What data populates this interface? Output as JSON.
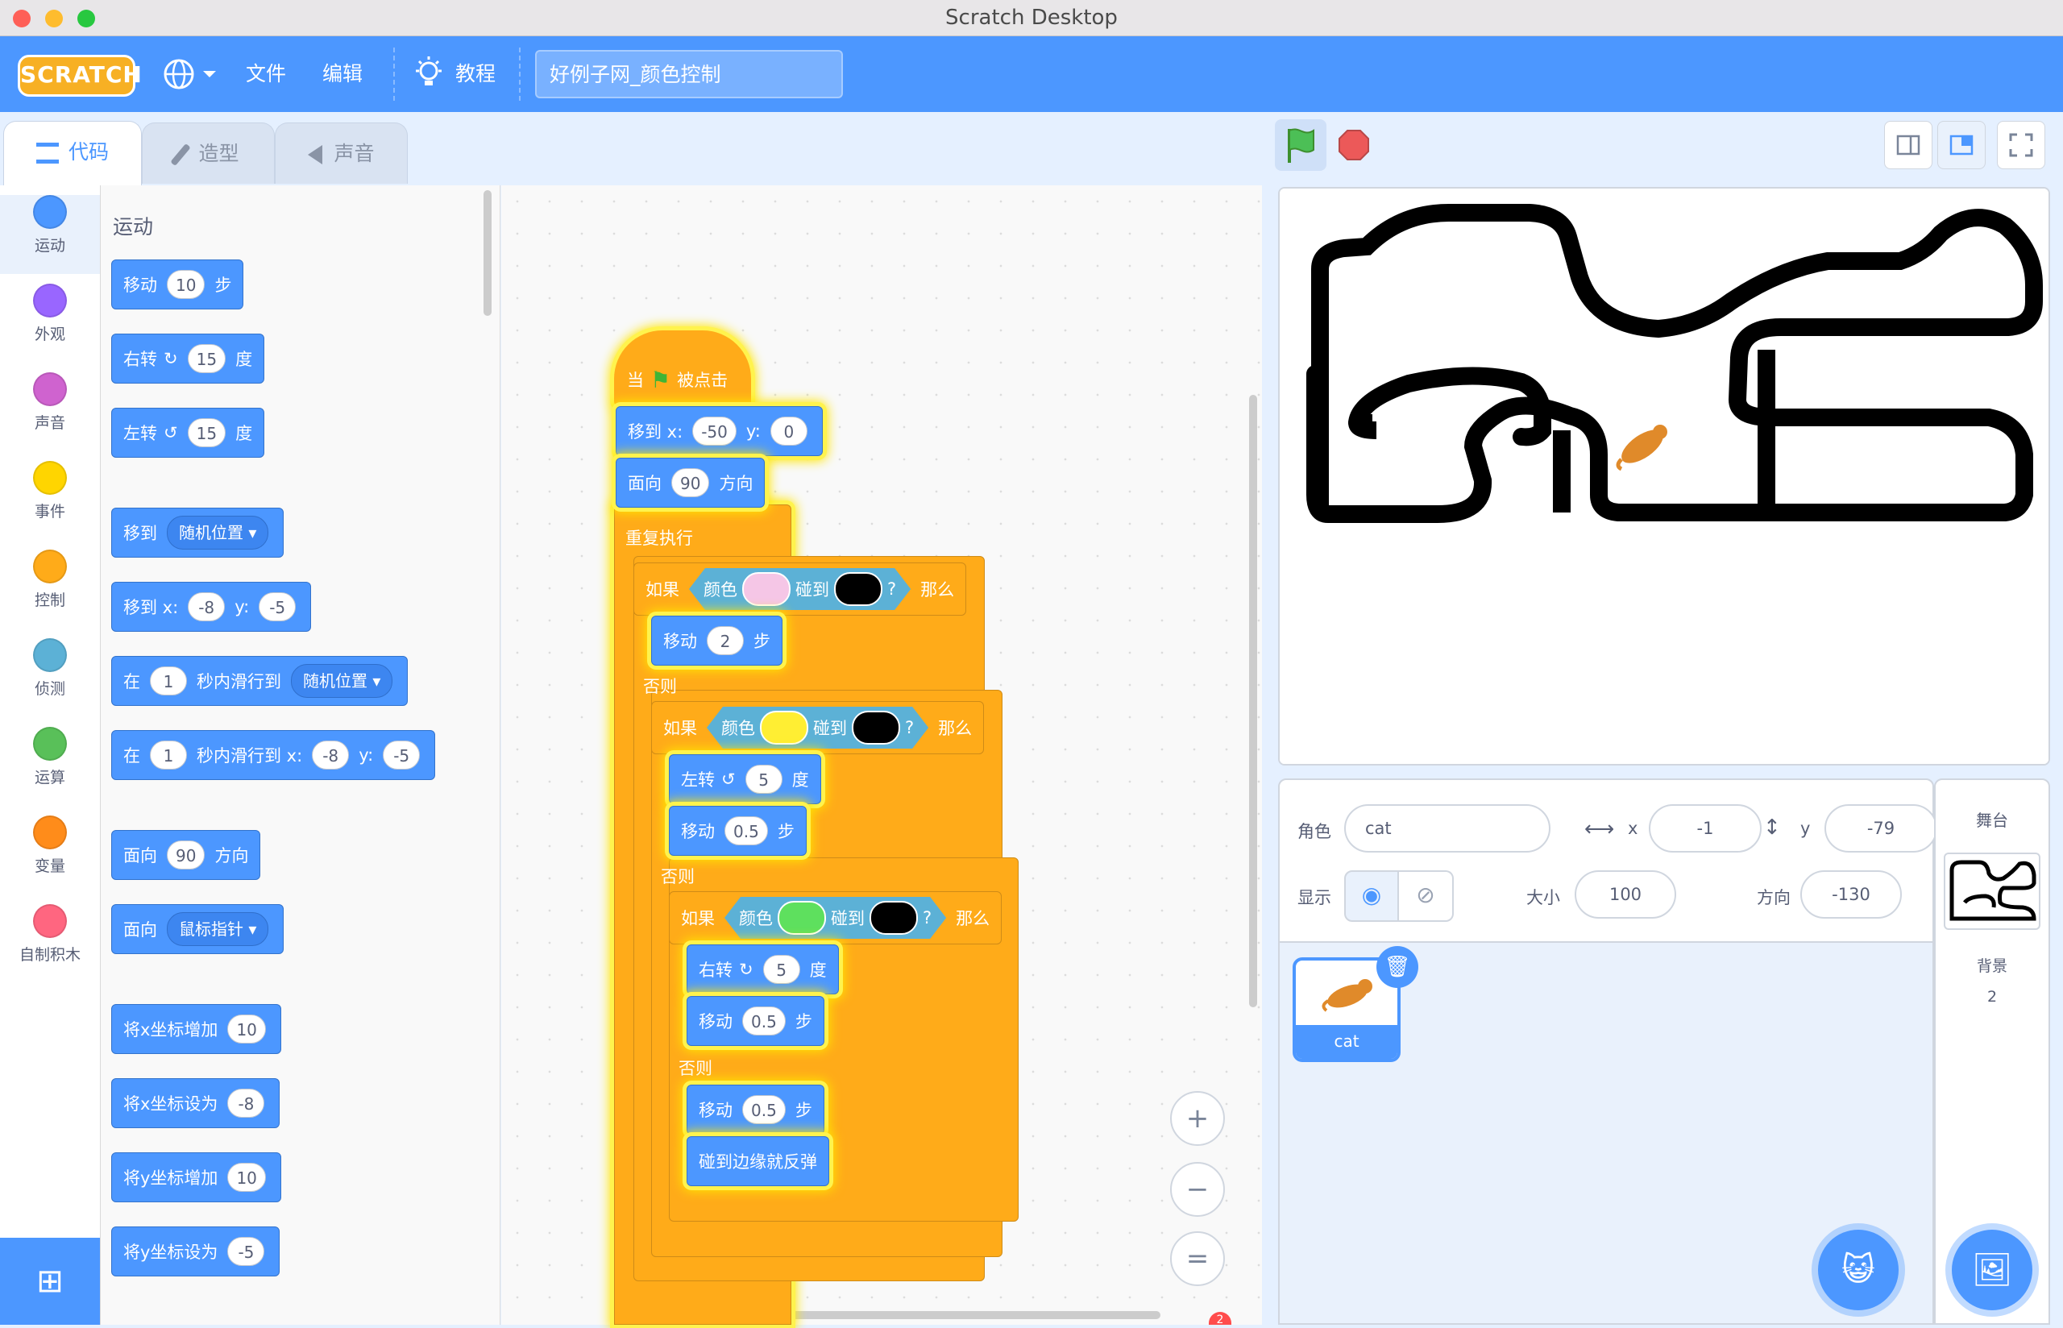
{
  "window": {
    "title": "Scratch Desktop"
  },
  "menubar": {
    "logo": "SCRATCH",
    "file": "文件",
    "edit": "编辑",
    "tutorials": "教程",
    "project_title": "好例子网_颜色控制"
  },
  "tabs": {
    "code": "代码",
    "costumes": "造型",
    "sounds": "声音"
  },
  "categories": [
    {
      "label": "运动",
      "color": "#4c97ff"
    },
    {
      "label": "外观",
      "color": "#9966ff"
    },
    {
      "label": "声音",
      "color": "#cf63cf"
    },
    {
      "label": "事件",
      "color": "#ffd500"
    },
    {
      "label": "控制",
      "color": "#ffab19"
    },
    {
      "label": "侦测",
      "color": "#5cb1d6"
    },
    {
      "label": "运算",
      "color": "#59c059"
    },
    {
      "label": "变量",
      "color": "#ff8c1a"
    },
    {
      "label": "自制积木",
      "color": "#ff6680"
    }
  ],
  "palette": {
    "heading": "运动",
    "move": {
      "a": "移动",
      "v": "10",
      "b": "步"
    },
    "turn_right": {
      "a": "右转",
      "v": "15",
      "b": "度"
    },
    "turn_left": {
      "a": "左转",
      "v": "15",
      "b": "度"
    },
    "goto": {
      "a": "移到",
      "menu": "随机位置"
    },
    "goto_xy": {
      "a": "移到 x:",
      "x": "-8",
      "ylbl": "y:",
      "y": "-5"
    },
    "glide": {
      "a": "在",
      "v": "1",
      "b": "秒内滑行到",
      "menu": "随机位置"
    },
    "glide_xy": {
      "a": "在",
      "v": "1",
      "b": "秒内滑行到 x:",
      "x": "-8",
      "ylbl": "y:",
      "y": "-5"
    },
    "point": {
      "a": "面向",
      "v": "90",
      "b": "方向"
    },
    "point_towards": {
      "a": "面向",
      "menu": "鼠标指针"
    },
    "change_x": {
      "a": "将x坐标增加",
      "v": "10"
    },
    "set_x": {
      "a": "将x坐标设为",
      "v": "-8"
    },
    "change_y": {
      "a": "将y坐标增加",
      "v": "10"
    },
    "set_y": {
      "a": "将y坐标设为",
      "v": "-5"
    }
  },
  "script": {
    "hat": {
      "a": "当",
      "b": "被点击"
    },
    "goto": {
      "a": "移到 x:",
      "x": "-50",
      "ylbl": "y:",
      "y": "0"
    },
    "point": {
      "a": "面向",
      "v": "90",
      "b": "方向"
    },
    "forever": "重复执行",
    "if1": {
      "a": "如果",
      "c": "颜色",
      "t": "碰到",
      "q": "?",
      "then": "那么",
      "color1": "#f5c6e6",
      "color2": "#000000"
    },
    "move1": {
      "a": "移动",
      "v": "2",
      "b": "步"
    },
    "else1": "否则",
    "if2": {
      "a": "如果",
      "c": "颜色",
      "t": "碰到",
      "q": "?",
      "then": "那么",
      "color1": "#ffee33",
      "color2": "#000000"
    },
    "turnl": {
      "a": "左转",
      "v": "5",
      "b": "度"
    },
    "move2": {
      "a": "移动",
      "v": "0.5",
      "b": "步"
    },
    "else2": "否则",
    "if3": {
      "a": "如果",
      "c": "颜色",
      "t": "碰到",
      "q": "?",
      "then": "那么",
      "color1": "#5ee05e",
      "color2": "#000000"
    },
    "turnr": {
      "a": "右转",
      "v": "5",
      "b": "度"
    },
    "move3": {
      "a": "移动",
      "v": "0.5",
      "b": "步"
    },
    "else3": "否则",
    "move4": {
      "a": "移动",
      "v": "0.5",
      "b": "步"
    },
    "bounce": "碰到边缘就反弹"
  },
  "zoom": {
    "in": "+",
    "out": "−",
    "reset": "="
  },
  "sprite_info": {
    "sprite_label": "角色",
    "sprite_name": "cat",
    "x_label": "x",
    "x": "-1",
    "y_label": "y",
    "y": "-79",
    "show_label": "显示",
    "size_label": "大小",
    "size": "100",
    "direction_label": "方向",
    "direction": "-130"
  },
  "sprites": [
    {
      "name": "cat"
    }
  ],
  "stage_panel": {
    "title": "舞台",
    "backdrop_label": "背景",
    "backdrop_count": "2"
  },
  "notification_badge": "2"
}
